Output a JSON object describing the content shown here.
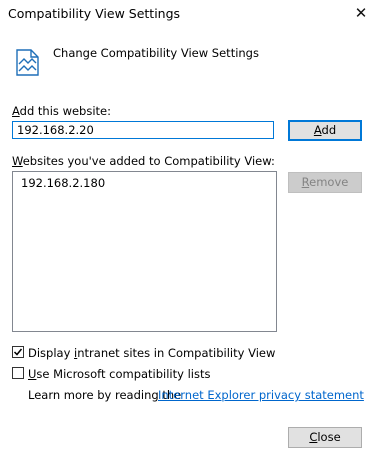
{
  "window": {
    "title": "Compatibility View Settings",
    "close_glyph": "✕"
  },
  "header": {
    "text": "Change Compatibility View Settings",
    "icon": "compatibility-view-icon"
  },
  "add_section": {
    "label_accel": "A",
    "label_rest": "dd this website:",
    "input_value": "192.168.2.20",
    "button_accel": "A",
    "button_rest": "dd"
  },
  "list_section": {
    "label_accel": "W",
    "label_rest": "ebsites you've added to Compatibility View:",
    "items": [
      "192.168.2.180"
    ],
    "remove_accel": "R",
    "remove_rest": "emove"
  },
  "options": {
    "intranet_checked": true,
    "intranet_pre": "Display ",
    "intranet_accel": "i",
    "intranet_post": "ntranet sites in Compatibility View",
    "ms_lists_checked": false,
    "ms_lists_accel": "U",
    "ms_lists_rest": "se Microsoft compatibility lists"
  },
  "learn_more": {
    "text": "Learn more by reading the",
    "link_text": "Internet Explorer privacy statement"
  },
  "footer": {
    "close_accel": "C",
    "close_rest": "lose"
  },
  "colors": {
    "accent": "#0078d7",
    "link": "#0066cc",
    "button_bg": "#e1e1e1",
    "disabled_text": "#838383"
  }
}
